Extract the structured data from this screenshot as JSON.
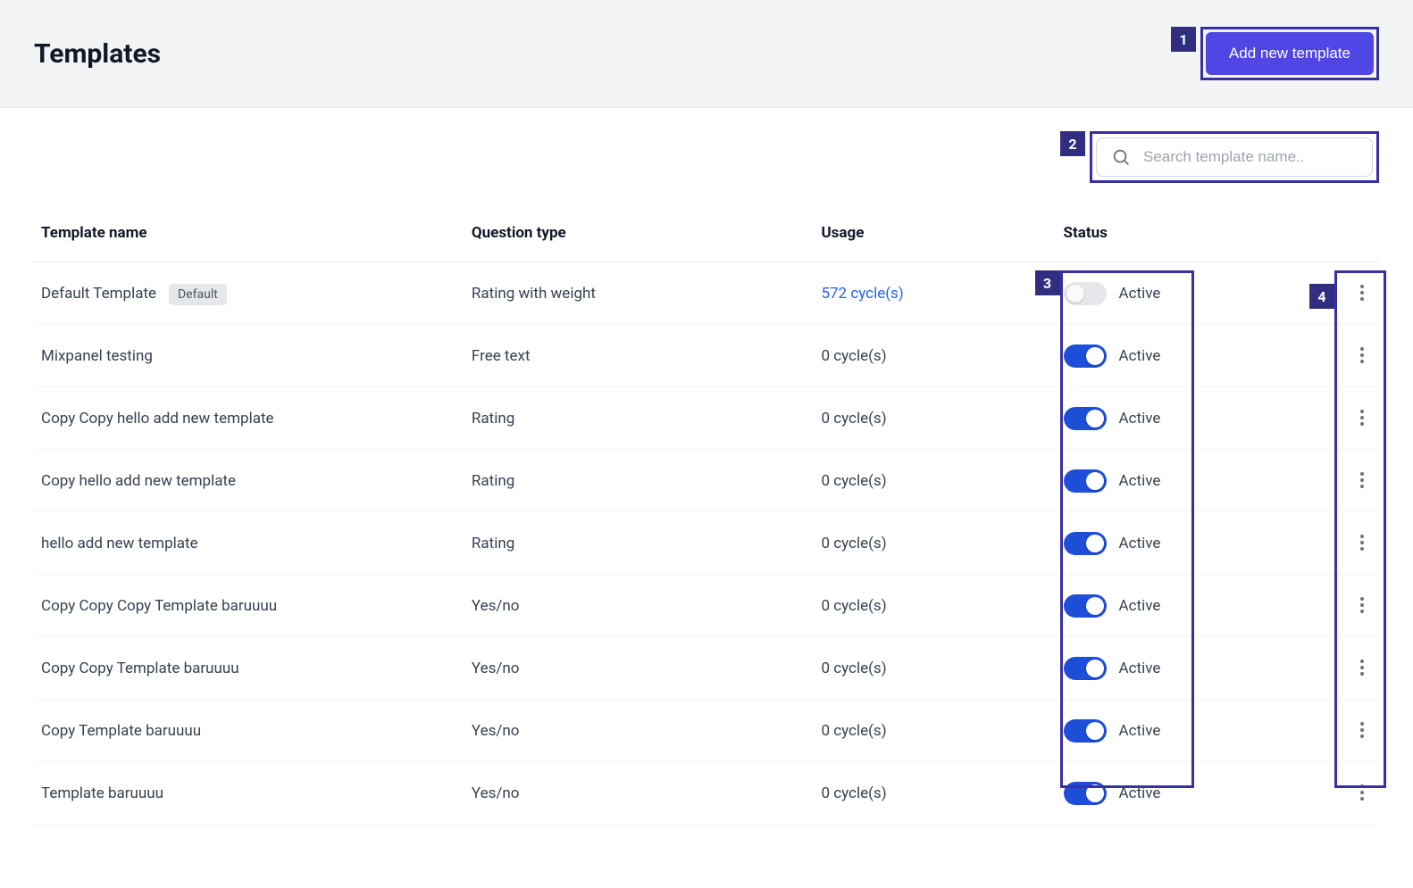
{
  "header": {
    "title": "Templates",
    "add_button": "Add new template"
  },
  "search": {
    "placeholder": "Search template name.."
  },
  "table": {
    "columns": {
      "name": "Template name",
      "type": "Question type",
      "usage": "Usage",
      "status": "Status"
    },
    "default_badge": "Default",
    "rows": [
      {
        "name": "Default Template",
        "is_default": true,
        "type": "Rating with weight",
        "usage": "572 cycle(s)",
        "usage_link": true,
        "status": "Active",
        "toggle_on": false
      },
      {
        "name": "Mixpanel testing",
        "type": "Free text",
        "usage": "0 cycle(s)",
        "status": "Active",
        "toggle_on": true
      },
      {
        "name": "Copy Copy hello add new template",
        "type": "Rating",
        "usage": "0 cycle(s)",
        "status": "Active",
        "toggle_on": true
      },
      {
        "name": "Copy hello add new template",
        "type": "Rating",
        "usage": "0 cycle(s)",
        "status": "Active",
        "toggle_on": true
      },
      {
        "name": "hello add new template",
        "type": "Rating",
        "usage": "0 cycle(s)",
        "status": "Active",
        "toggle_on": true
      },
      {
        "name": "Copy Copy Copy Template baruuuu",
        "type": "Yes/no",
        "usage": "0 cycle(s)",
        "status": "Active",
        "toggle_on": true
      },
      {
        "name": "Copy Copy Template baruuuu",
        "type": "Yes/no",
        "usage": "0 cycle(s)",
        "status": "Active",
        "toggle_on": true
      },
      {
        "name": "Copy Template baruuuu",
        "type": "Yes/no",
        "usage": "0 cycle(s)",
        "status": "Active",
        "toggle_on": true
      },
      {
        "name": "Template baruuuu",
        "type": "Yes/no",
        "usage": "0 cycle(s)",
        "status": "Active",
        "toggle_on": true
      }
    ]
  },
  "callouts": {
    "1": "1",
    "2": "2",
    "3": "3",
    "4": "4"
  }
}
